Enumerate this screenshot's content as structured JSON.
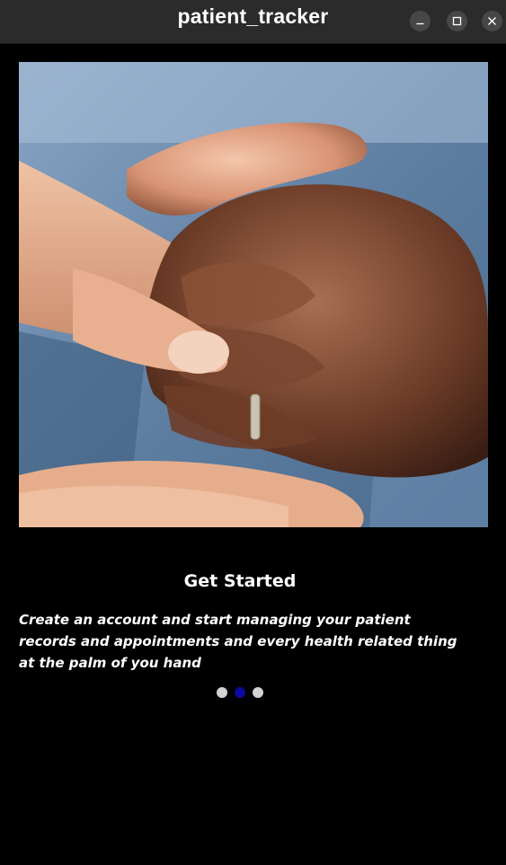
{
  "window": {
    "title": "patient_tracker"
  },
  "controls": {
    "minimize": "minimize-icon",
    "maximize": "maximize-icon",
    "close": "close-icon"
  },
  "onboarding": {
    "heading": "Get Started",
    "description": "Create an account and start managing your patient records and appointments and every health related thing at the palm of you hand",
    "pages": 3,
    "active_page": 2
  },
  "colors": {
    "titlebar": "#2b2b2b",
    "background": "#000000",
    "dot_inactive": "#d3d3d3",
    "dot_active": "#0a0a9e"
  }
}
